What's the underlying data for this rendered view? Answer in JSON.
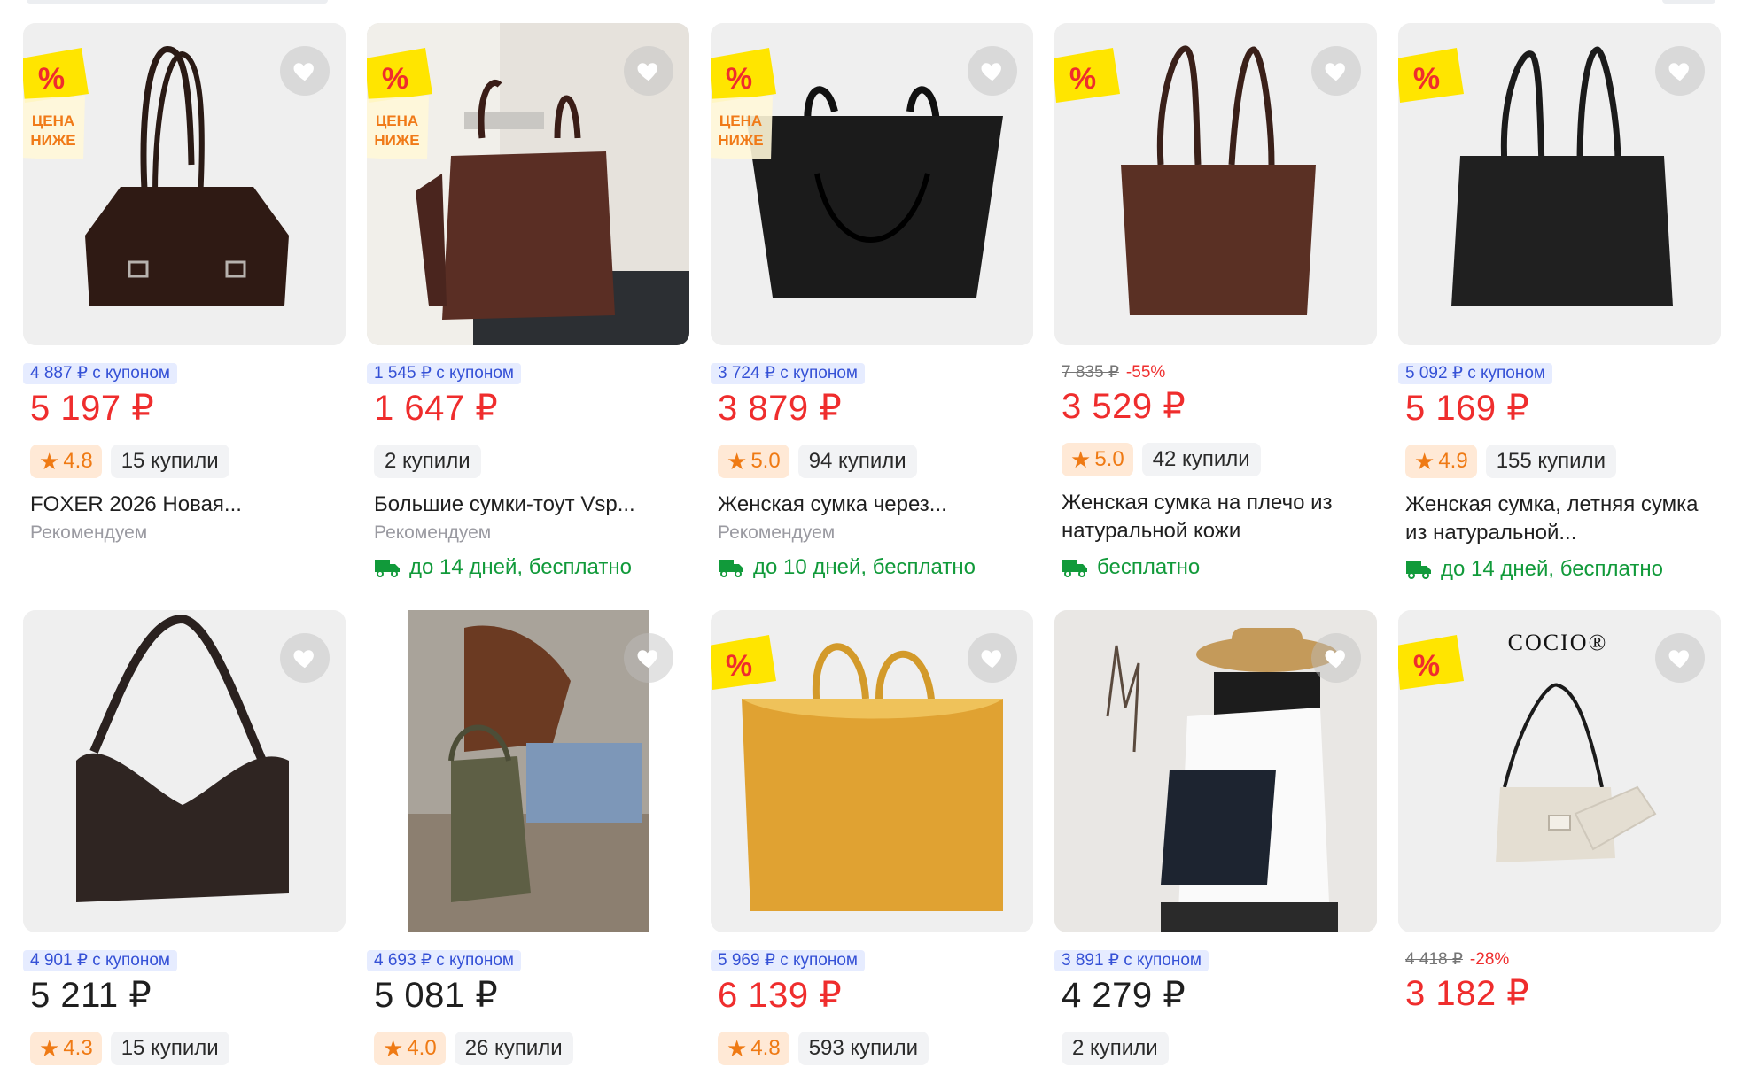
{
  "colors": {
    "price_red": "#ef2d2d",
    "coupon_blue": "#3551d6",
    "rating_orange": "#ef7a14",
    "delivery_green": "#119a3a",
    "promo_yellow": "#ffe500"
  },
  "promo": {
    "percent": "%",
    "line1": "ЦЕНА",
    "line2": "НИЖЕ"
  },
  "icons": {
    "favorite": "heart-icon",
    "rating": "star-icon",
    "delivery": "truck-icon"
  },
  "products": [
    {
      "coupon": "4 887 ₽ с купоном",
      "price": "5 197 ₽",
      "rating": "4.8",
      "bought": "15 купили",
      "title": "FOXER 2026 Новая...",
      "recommend": "Рекомендуем"
    },
    {
      "coupon": "1 545 ₽ с купоном",
      "price": "1 647 ₽",
      "bought": "2 купили",
      "title": "Большие сумки-тоут Vsp...",
      "recommend": "Рекомендуем",
      "delivery": "до 14 дней, бесплатно"
    },
    {
      "coupon": "3 724 ₽ с купоном",
      "price": "3 879 ₽",
      "rating": "5.0",
      "bought": "94 купили",
      "title": "Женская сумка через...",
      "recommend": "Рекомендуем",
      "delivery": "до 10 дней, бесплатно"
    },
    {
      "old_price": "7 835 ₽",
      "discount": "-55%",
      "price": "3 529 ₽",
      "rating": "5.0",
      "bought": "42 купили",
      "title": "Женская сумка на плечо из натуральной кожи",
      "delivery": "бесплатно"
    },
    {
      "coupon": "5 092 ₽ с купоном",
      "price": "5 169 ₽",
      "rating": "4.9",
      "bought": "155 купили",
      "title": "Женская сумка, летняя сумка из натуральной...",
      "delivery": "до 14 дней, бесплатно"
    },
    {
      "coupon": "4 901 ₽ с купоном",
      "price": "5 211 ₽",
      "rating": "4.3",
      "bought": "15 купили"
    },
    {
      "coupon": "4 693 ₽ с купоном",
      "price": "5 081 ₽",
      "rating": "4.0",
      "bought": "26 купили"
    },
    {
      "coupon": "5 969 ₽ с купоном",
      "price": "6 139 ₽",
      "rating": "4.8",
      "bought": "593 купили"
    },
    {
      "coupon": "3 891 ₽ с купоном",
      "price": "4 279 ₽",
      "bought": "2 купили"
    },
    {
      "old_price": "4 418 ₽",
      "discount": "-28%",
      "price": "3 182 ₽",
      "brand_logo": "COCIO®"
    }
  ]
}
